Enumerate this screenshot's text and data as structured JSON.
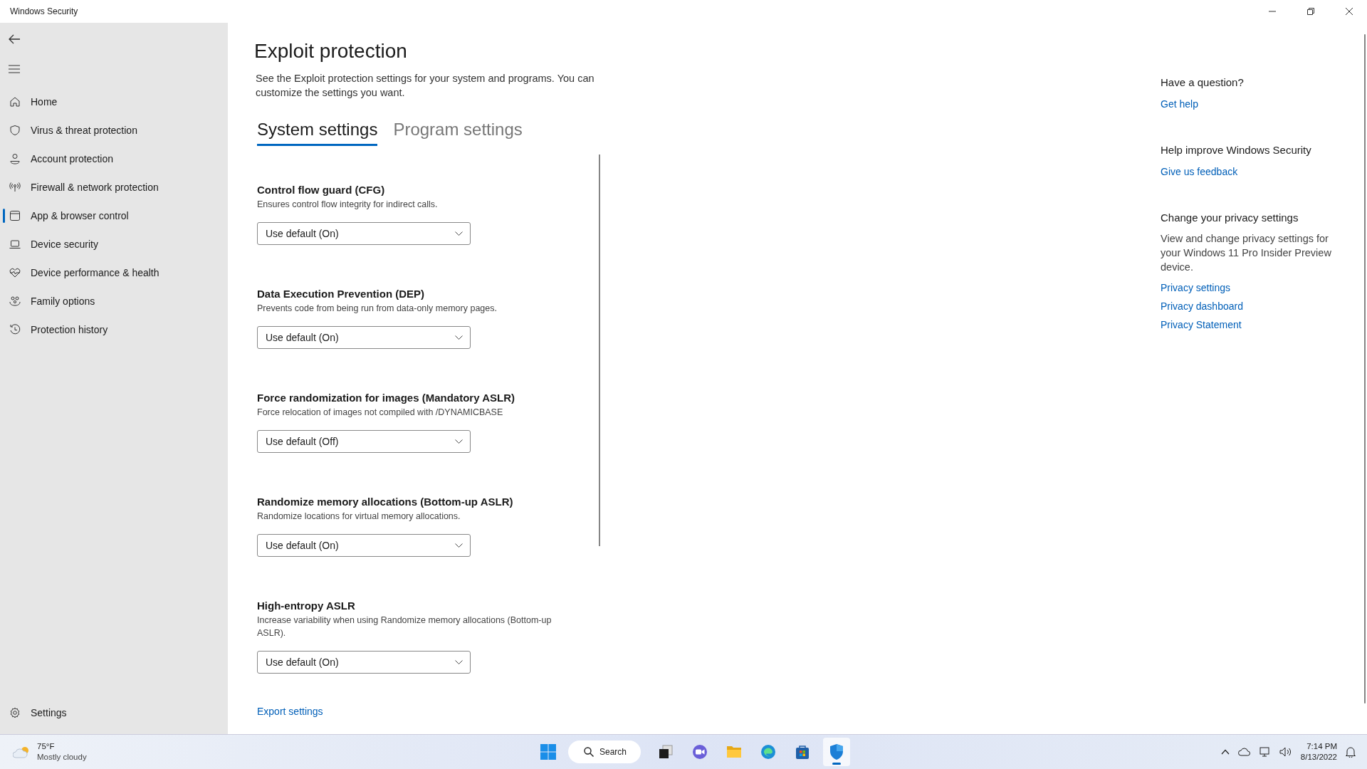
{
  "window": {
    "title": "Windows Security"
  },
  "sidebar": {
    "items": [
      {
        "label": "Home",
        "selected": false
      },
      {
        "label": "Virus & threat protection",
        "selected": false
      },
      {
        "label": "Account protection",
        "selected": false
      },
      {
        "label": "Firewall & network protection",
        "selected": false
      },
      {
        "label": "App & browser control",
        "selected": true
      },
      {
        "label": "Device security",
        "selected": false
      },
      {
        "label": "Device performance & health",
        "selected": false
      },
      {
        "label": "Family options",
        "selected": false
      },
      {
        "label": "Protection history",
        "selected": false
      }
    ],
    "settings": "Settings"
  },
  "page": {
    "title": "Exploit protection",
    "description": "See the Exploit protection settings for your system and programs.  You can customize the settings you want.",
    "tabs": [
      {
        "label": "System settings",
        "selected": true
      },
      {
        "label": "Program settings",
        "selected": false
      }
    ],
    "settings": [
      {
        "title": "Control flow guard (CFG)",
        "description": "Ensures control flow integrity for indirect calls.",
        "value": "Use default (On)"
      },
      {
        "title": "Data Execution Prevention (DEP)",
        "description": "Prevents code from being run from data-only memory pages.",
        "value": "Use default (On)"
      },
      {
        "title": "Force randomization for images (Mandatory ASLR)",
        "description": "Force relocation of images not compiled with /DYNAMICBASE",
        "value": "Use default (Off)"
      },
      {
        "title": "Randomize memory allocations (Bottom-up ASLR)",
        "description": "Randomize locations for virtual memory allocations.",
        "value": "Use default (On)"
      },
      {
        "title": "High-entropy ASLR",
        "description": "Increase variability when using Randomize memory allocations (Bottom-up ASLR).",
        "value": "Use default (On)"
      }
    ],
    "export_link": "Export settings"
  },
  "side_panel": [
    {
      "heading": "Have a question?",
      "links": [
        "Get help"
      ]
    },
    {
      "heading": "Help improve Windows Security",
      "links": [
        "Give us feedback"
      ]
    },
    {
      "heading": "Change your privacy settings",
      "text": "View and change privacy settings for your Windows 11 Pro Insider Preview device.",
      "links": [
        "Privacy settings",
        "Privacy dashboard",
        "Privacy Statement"
      ]
    }
  ],
  "taskbar": {
    "weather": {
      "temperature": "75°F",
      "condition": "Mostly cloudy"
    },
    "search": "Search",
    "apps": [
      {
        "selected": false
      },
      {
        "selected": false
      },
      {
        "selected": false
      },
      {
        "selected": false
      },
      {
        "selected": false
      },
      {
        "selected": true
      }
    ],
    "time": "7:14 PM",
    "date": "8/13/2022"
  }
}
